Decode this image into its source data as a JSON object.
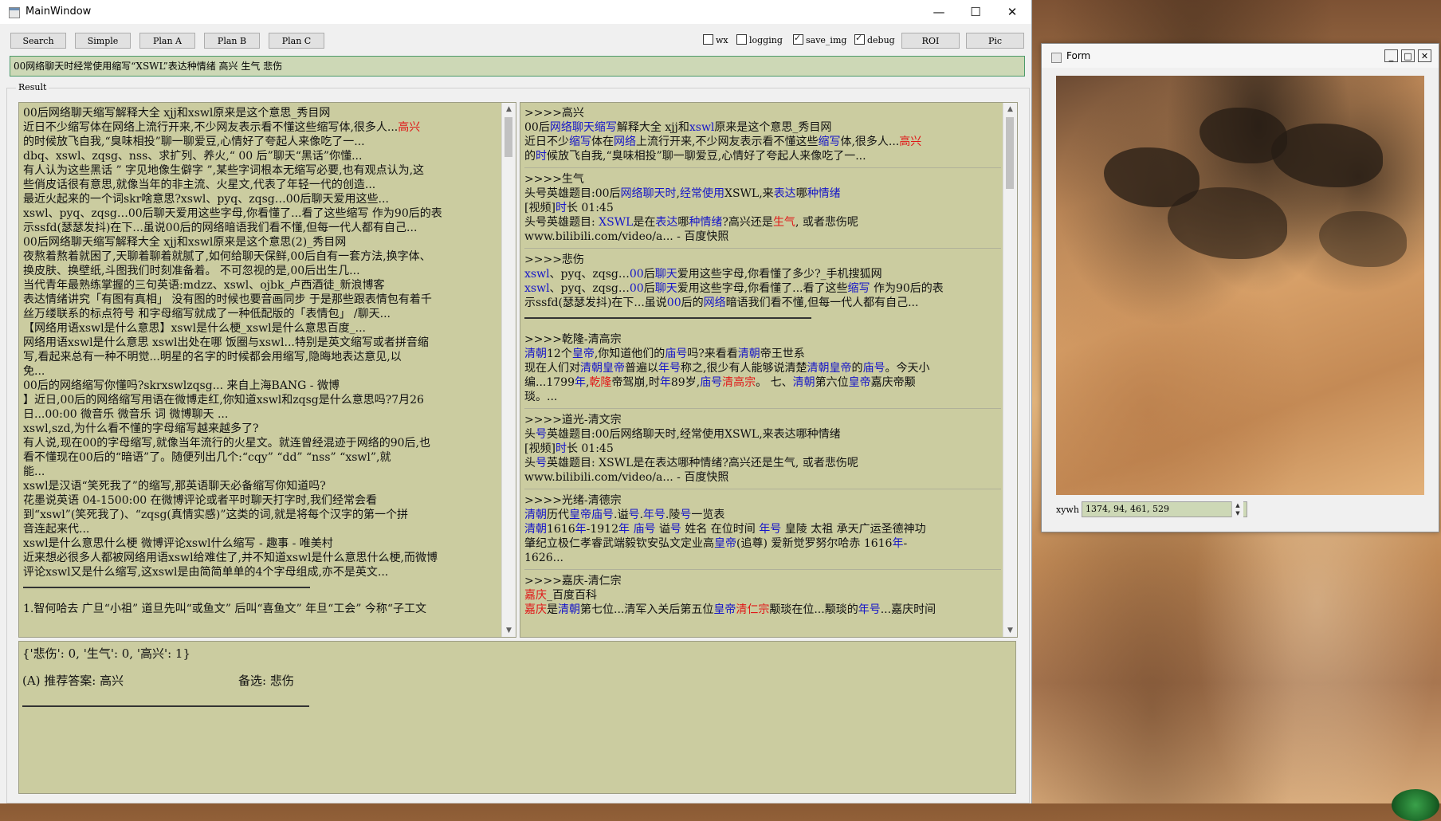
{
  "main_window": {
    "title": "MainWindow",
    "controls": {
      "minimize": "—",
      "maximize": "☐",
      "close": "✕"
    }
  },
  "toolbar": {
    "buttons": [
      "Search",
      "Simple",
      "Plan A",
      "Plan B",
      "Plan C",
      "ROI",
      "Pic"
    ],
    "checkboxes": [
      {
        "label": "wx",
        "checked": false
      },
      {
        "label": "logging",
        "checked": false
      },
      {
        "label": "save_img",
        "checked": true
      },
      {
        "label": "debug",
        "checked": true
      }
    ]
  },
  "query": "00网络聊天时经常使用缩写“XSWL”表达种情绪 高兴 生气 悲伤",
  "result_group": {
    "label": "Result"
  },
  "left_pane": {
    "lines": [
      "00后网络聊天缩写解释大全 xjj和xswl原来是这个意思_秀目网",
      "近日不少缩写体在网络上流行开来,不少网友表示看不懂这些缩写体,很多人...",
      "的时候放飞自我,“臭味相投”聊一聊爱豆,心情好了夸起人来像吃了一...",
      "dbq、xswl、zqsg、nss、求扩列、养火,“ 00 后”聊天“黑话”你懂...",
      "有人认为这些黑话 ” 字见地像生僻字 ”,某些字词根本无缩写必要,也有观点认为,这",
      "些俏皮话很有意思,就像当年的非主流、火星文,代表了年轻一代的创造...",
      "最近火起来的一个词skr啥意思?xswl、pyq、zqsg…00后聊天爱用这些...",
      "xswl、pyq、zqsg…00后聊天爱用这些字母,你看懂了...看了这些缩写 作为90后的表",
      "示ssfd(瑟瑟发抖)在下...虽说00后的网络暗语我们看不懂,但每一代人都有自己...",
      "00后网络聊天缩写解释大全 xjj和xswl原来是这个意思(2)_秀目网",
      "夜熬着熬着就困了,天聊着聊着就腻了,如何给聊天保鲜,00后自有一套方法,换字体、",
      "换皮肤、换壁纸,斗图我们时刻准备着。 不可忽视的是,00后出生几...",
      "当代青年最熟练掌握的三句英语:mdzz、xswl、ojbk_卢西酒徒_新浪博客",
      "表达情绪讲究「有图有真相」 没有图的时候也要音画同步 于是那些跟表情包有着千",
      "丝万缕联系的标点符号 和字母缩写就成了一种低配版的「表情包」 /聊天...",
      "【网络用语xswl是什么意思】xswl是什么梗_xswl是什么意思百度_...",
      "网络用语xswl是什么意思 xswl出处在哪 饭圈与xswl...特别是英文缩写或者拼音缩",
      "写,看起来总有一种不明觉...明星的名字的时候都会用缩写,隐晦地表达意见,以",
      "免...",
      "00后的网络缩写你懂吗?skrxswlzqsg... 来自上海BANG - 微博",
      "】近日,00后的网络缩写用语在微博走红,你知道xswl和zqsg是什么意思吗?7月26",
      "日...00:00 微音乐 微音乐 词 微博聊天 ...",
      "xswl,szd,为什么看不懂的字母缩写越来越多了?",
      "有人说,现在00的字母缩写,就像当年流行的火星文。就连曾经混迹于网络的90后,也",
      "看不懂现在00后的“暗语”了。随便列出几个:“cqy” “dd” “nss” “xswl”,就",
      "能...",
      "xswl是汉语“笑死我了”的缩写,那英语聊天必备缩写你知道吗?",
      "花墨说英语 04-1500:00 在微博评论或者平时聊天打字时,我们经常会看",
      "到“xswl”(笑死我了)、“zqsg(真情实感)”这类的词,就是将每个汉字的第一个拼",
      "音连起来代...",
      "xswl是什么意思什么梗 微博评论xswl什么缩写 - 趣事 - 唯美村",
      "近来想必很多人都被网络用语xswl给难住了,并不知道xswl是什么意思什么梗,而微博",
      "评论xswl又是什么缩写,这xswl是由简简单单的4个字母组成,亦不是英文..."
    ],
    "red_word": "高兴",
    "trailing": "1.智何哈去 广旦“小祖” 道旦先叫“或鱼文” 后叫“喜鱼文” 年旦“工会” 今称“子工文"
  },
  "right_pane": {
    "sections": [
      {
        "head": ">>>>高兴",
        "lines": [
          [
            [
              "00后",
              ""
            ],
            [
              "网络聊天缩写",
              "blue"
            ],
            [
              "解释大全 xjj和",
              ""
            ],
            [
              "xswl",
              "blue"
            ],
            [
              "原来是这个意思_秀目网",
              ""
            ]
          ],
          [
            [
              "近日不少",
              ""
            ],
            [
              "缩写",
              "blue"
            ],
            [
              "体在",
              ""
            ],
            [
              "网络",
              "blue"
            ],
            [
              "上流行开来,不少网友表示看不懂这些",
              ""
            ],
            [
              "缩写",
              "blue"
            ],
            [
              "体,很多人...",
              ""
            ],
            [
              "高兴",
              "red"
            ]
          ],
          [
            [
              "的",
              ""
            ],
            [
              "时",
              "blue"
            ],
            [
              "候放飞自我,“臭味相投”聊一聊爱豆,心情好了夸起人来像吃了一...",
              ""
            ]
          ]
        ]
      },
      {
        "head": ">>>>生气",
        "lines": [
          [
            [
              "头号英雄题目:00后",
              ""
            ],
            [
              "网络聊天时",
              "blue"
            ],
            [
              ",",
              ""
            ],
            [
              "经常使用",
              "blue"
            ],
            [
              "XSWL,来",
              ""
            ],
            [
              "表达",
              "blue"
            ],
            [
              "哪",
              ""
            ],
            [
              "种情绪",
              "blue"
            ]
          ],
          [
            [
              "[视频]",
              ""
            ],
            [
              "时",
              "blue"
            ],
            [
              "长 01:45",
              ""
            ]
          ],
          [
            [
              "头号英雄题目: ",
              ""
            ],
            [
              "XSWL",
              "blue"
            ],
            [
              "是在",
              ""
            ],
            [
              "表达",
              "blue"
            ],
            [
              "哪",
              ""
            ],
            [
              "种情绪",
              "blue"
            ],
            [
              "?高兴还是",
              ""
            ],
            [
              "生气",
              "red"
            ],
            [
              ", 或者悲伤呢",
              ""
            ]
          ],
          [
            [
              "www.bilibili.com/video/a... - 百度快照",
              ""
            ]
          ]
        ]
      },
      {
        "head": ">>>>悲伤",
        "lines": [
          [
            [
              "xswl",
              "blue"
            ],
            [
              "、pyq、zqsg…",
              ""
            ],
            [
              "00",
              "blue"
            ],
            [
              "后",
              ""
            ],
            [
              "聊天",
              "blue"
            ],
            [
              "爱用这些字母,你看懂了多少?_手机搜狐网",
              ""
            ]
          ],
          [
            [
              "xswl",
              "blue"
            ],
            [
              "、pyq、zqsg…",
              ""
            ],
            [
              "00",
              "blue"
            ],
            [
              "后",
              ""
            ],
            [
              "聊天",
              "blue"
            ],
            [
              "爱用这些字母,你看懂了...看了这些",
              ""
            ],
            [
              "缩写",
              "blue"
            ],
            [
              " 作为90后的表",
              ""
            ]
          ],
          [
            [
              "示ssfd(瑟瑟发抖)在下...虽说",
              ""
            ],
            [
              "00",
              "blue"
            ],
            [
              "后的",
              ""
            ],
            [
              "网络",
              "blue"
            ],
            [
              "暗语我们看不懂,但每一代人都有自己...",
              ""
            ]
          ]
        ]
      },
      {
        "head": ">>>>乾隆-清高宗",
        "lines": [
          [
            [
              "清朝",
              "blue"
            ],
            [
              "12个",
              ""
            ],
            [
              "皇帝",
              "blue"
            ],
            [
              ",你知道他们的",
              ""
            ],
            [
              "庙号",
              "blue"
            ],
            [
              "吗?来看看",
              ""
            ],
            [
              "清朝",
              "blue"
            ],
            [
              "帝王世系",
              ""
            ]
          ],
          [
            [
              "现在人们对",
              ""
            ],
            [
              "清朝皇帝",
              "blue"
            ],
            [
              "普遍以",
              ""
            ],
            [
              "年号",
              "blue"
            ],
            [
              "称之,很少有人能够说清楚",
              ""
            ],
            [
              "清朝皇帝",
              "blue"
            ],
            [
              "的",
              ""
            ],
            [
              "庙号",
              "blue"
            ],
            [
              "。今天小",
              ""
            ]
          ],
          [
            [
              "编...1799",
              ""
            ],
            [
              "年",
              "blue"
            ],
            [
              ",",
              ""
            ],
            [
              "乾隆",
              "red"
            ],
            [
              "帝驾崩,时",
              ""
            ],
            [
              "年",
              "blue"
            ],
            [
              "89岁,",
              ""
            ],
            [
              "庙号",
              "blue"
            ],
            [
              "清高宗",
              "red"
            ],
            [
              "。 七、",
              ""
            ],
            [
              "清朝",
              "blue"
            ],
            [
              "第六位",
              ""
            ],
            [
              "皇帝",
              "blue"
            ],
            [
              "嘉庆帝颙",
              ""
            ]
          ],
          [
            [
              "琰。...",
              ""
            ]
          ]
        ]
      },
      {
        "head": ">>>>道光-清文宗",
        "lines": [
          [
            [
              "头",
              ""
            ],
            [
              "号",
              "blue"
            ],
            [
              "英雄题目:00后网络聊天时,经常使用XSWL,来表达哪种情绪",
              ""
            ]
          ],
          [
            [
              "[视频]",
              ""
            ],
            [
              "时",
              "blue"
            ],
            [
              "长 01:45",
              ""
            ]
          ],
          [
            [
              "头",
              ""
            ],
            [
              "号",
              "blue"
            ],
            [
              "英雄题目: XSWL是在表达哪种情绪?高兴还是生气, 或者悲伤呢",
              ""
            ]
          ],
          [
            [
              "www.bilibili.com/video/a... - 百度快照",
              ""
            ]
          ]
        ]
      },
      {
        "head": ">>>>光绪-清德宗",
        "lines": [
          [
            [
              "清朝",
              "blue"
            ],
            [
              "历代",
              ""
            ],
            [
              "皇帝庙号",
              "blue"
            ],
            [
              ".谥",
              ""
            ],
            [
              "号",
              "blue"
            ],
            [
              ".",
              ""
            ],
            [
              "年号",
              "blue"
            ],
            [
              ".陵",
              ""
            ],
            [
              "号",
              "blue"
            ],
            [
              "一览表",
              ""
            ]
          ],
          [
            [
              "清朝",
              "blue"
            ],
            [
              "1616",
              ""
            ],
            [
              "年",
              "blue"
            ],
            [
              "-1912",
              ""
            ],
            [
              "年",
              "blue"
            ],
            [
              " ",
              ""
            ],
            [
              "庙号",
              "blue"
            ],
            [
              " 谥",
              ""
            ],
            [
              "号",
              "blue"
            ],
            [
              " 姓名 在位时间 ",
              ""
            ],
            [
              "年号",
              "blue"
            ],
            [
              " 皇陵 太祖 承天广运圣德神功",
              ""
            ]
          ],
          [
            [
              "肇纪立极仁孝睿武端毅钦安弘文定业高",
              ""
            ],
            [
              "皇帝",
              "blue"
            ],
            [
              "(追尊) 爱新觉罗努尔哈赤 1616",
              ""
            ],
            [
              "年",
              "blue"
            ],
            [
              "-",
              ""
            ]
          ],
          [
            [
              "1626...",
              ""
            ]
          ]
        ]
      },
      {
        "head": ">>>>嘉庆-清仁宗",
        "lines": [
          [
            [
              "嘉庆",
              "red"
            ],
            [
              "_百度百科",
              ""
            ]
          ],
          [
            [
              "嘉庆",
              "red"
            ],
            [
              "是",
              ""
            ],
            [
              "清朝",
              "blue"
            ],
            [
              "第七位...清军入关后第五位",
              ""
            ],
            [
              "皇帝",
              "blue"
            ],
            [
              "清仁宗",
              "red"
            ],
            [
              "颙琰在位...颙琰的",
              ""
            ],
            [
              "年号",
              "blue"
            ],
            [
              "...嘉庆时间",
              ""
            ]
          ]
        ]
      }
    ]
  },
  "result": {
    "line1": "{'悲伤': 0, '生气': 0, '高兴': 1}",
    "line2_prefix": "(A) 推荐答案: 高兴",
    "line2_alt": "备选: 悲伤"
  },
  "form_window": {
    "title": "Form",
    "xywh_label": "xywh",
    "xywh_value": "1374, 94, 461, 529"
  }
}
